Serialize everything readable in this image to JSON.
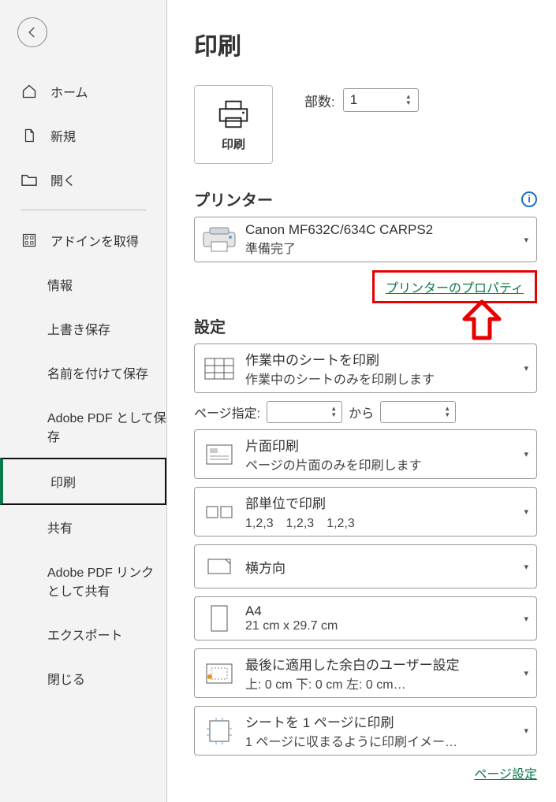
{
  "sidebar": {
    "home": "ホーム",
    "new": "新規",
    "open": "開く",
    "getAddin": "アドインを取得",
    "info": "情報",
    "save": "上書き保存",
    "saveAs": "名前を付けて保存",
    "adobeSave": "Adobe PDF として保存",
    "print": "印刷",
    "share": "共有",
    "adobeShare": "Adobe PDF リンクとして共有",
    "export": "エクスポート",
    "close": "閉じる"
  },
  "page": {
    "title": "印刷",
    "printBtn": "印刷",
    "copiesLabel": "部数:",
    "copiesValue": "1",
    "printerHead": "プリンター",
    "printerName": "Canon MF632C/634C CARPS2",
    "printerStatus": "準備完了",
    "printerProps": "プリンターのプロパティ",
    "settingsHead": "設定",
    "pageRangeLabel": "ページ指定:",
    "pageRangeFrom": "",
    "pageRangeSep": "から",
    "pageRangeTo": "",
    "pageSetupLink": "ページ設定"
  },
  "settings": {
    "scope": {
      "line1": "作業中のシートを印刷",
      "line2": "作業中のシートのみを印刷します"
    },
    "sides": {
      "line1": "片面印刷",
      "line2": "ページの片面のみを印刷します"
    },
    "collate": {
      "line1": "部単位で印刷",
      "line2": "1,2,3　1,2,3　1,2,3"
    },
    "orient": {
      "line1": "横方向"
    },
    "paper": {
      "line1": "A4",
      "line2": "21 cm x 29.7 cm"
    },
    "margins": {
      "line1": "最後に適用した余白のユーザー設定",
      "line2": "上: 0 cm 下: 0 cm 左: 0 cm…"
    },
    "scaling": {
      "line1": "シートを 1 ページに印刷",
      "line2": "1 ページに収まるように印刷イメー…"
    }
  }
}
